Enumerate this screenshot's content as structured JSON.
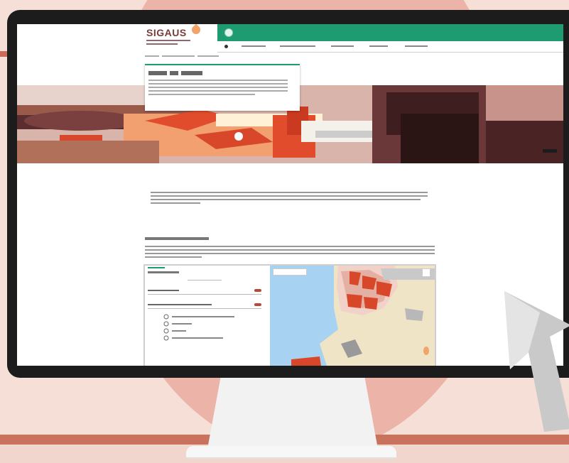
{
  "brand": {
    "logo_text": "SIGAUS"
  },
  "colors": {
    "header_green": "#1f9b72",
    "brand_brown": "#7a3d38",
    "accent_red": "#d9472b",
    "map_water": "#a8d2f2",
    "map_land": "#f0e4c6"
  },
  "icons": {
    "logo": "oil-drop-icon",
    "cursor": "mouse-pointer-icon"
  }
}
